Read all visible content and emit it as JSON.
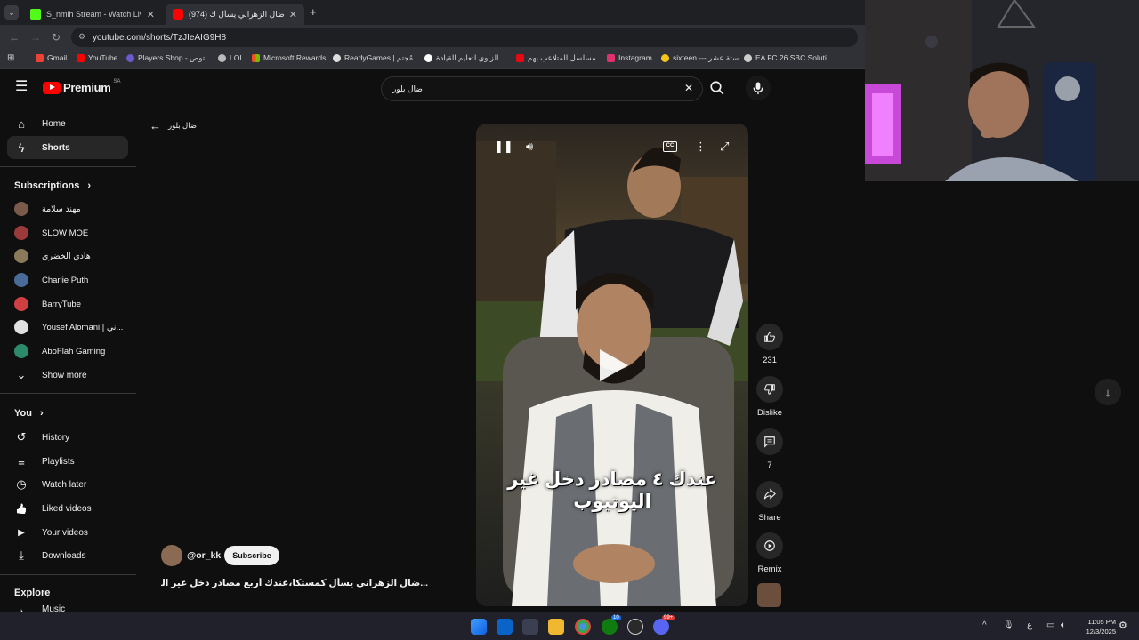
{
  "browser": {
    "tabs": [
      {
        "label": "S_nmlh Stream - Watch Live on",
        "color": "#53fc18"
      },
      {
        "label": "(974) ضال الزهراني يسأل ك",
        "color": "#ff0000"
      }
    ],
    "url": "youtube.com/shorts/TzJIeAIG9H8",
    "bookmarks": [
      {
        "label": "Gmail",
        "color": "#ea4335"
      },
      {
        "label": "YouTube",
        "color": "#ff0000"
      },
      {
        "label": "Players Shop - توص...",
        "color": "#6a5acd"
      },
      {
        "label": "LOL",
        "color": "#bbbbbb"
      },
      {
        "label": "Microsoft Rewards",
        "color": "#00a4ef"
      },
      {
        "label": "ReadyGames | مُجتم...",
        "color": "#ffffff"
      },
      {
        "label": "الزاوي لتعليم القيادة",
        "color": "#ffffff"
      },
      {
        "label": "مسلسل المتلاعب بهم...",
        "color": "#e50914"
      },
      {
        "label": "Instagram",
        "color": "#e1306c"
      },
      {
        "label": "sixteen --- ستة عشر",
        "color": "#f5c518"
      },
      {
        "label": "EA FC 26 SBC Soluti...",
        "color": "#cccccc"
      }
    ]
  },
  "masthead": {
    "logo_text": "Premium",
    "logo_sup": "SA",
    "search_value": "ضال بلور"
  },
  "sidebar": {
    "main": [
      {
        "label": "Home",
        "icon": "home-icon",
        "glyph": "⌂"
      },
      {
        "label": "Shorts",
        "icon": "shorts-icon",
        "glyph": "ϟ"
      }
    ],
    "subscriptions_title": "Subscriptions",
    "subscriptions": [
      {
        "label": "مهند سلامة",
        "color": "#7a5a4a"
      },
      {
        "label": "SLOW MOE",
        "color": "#9a3a3a"
      },
      {
        "label": "هادي الخضري",
        "color": "#8a7a5a"
      },
      {
        "label": "Charlie Puth",
        "color": "#4a6a9a"
      },
      {
        "label": "BarryTube",
        "color": "#d04040"
      },
      {
        "label": "Yousef Alomani | ني...",
        "color": "#e0e0e0"
      },
      {
        "label": "AboFlah Gaming",
        "color": "#2a8a6a"
      }
    ],
    "show_more": "Show more",
    "you_title": "You",
    "you": [
      {
        "label": "History",
        "icon": "history-icon",
        "glyph": "↺"
      },
      {
        "label": "Playlists",
        "icon": "playlists-icon",
        "glyph": "≡"
      },
      {
        "label": "Watch later",
        "icon": "watch-later-icon",
        "glyph": "◷"
      },
      {
        "label": "Liked videos",
        "icon": "like-icon",
        "glyph": "👍"
      },
      {
        "label": "Your videos",
        "icon": "your-videos-icon",
        "glyph": "▶"
      },
      {
        "label": "Downloads",
        "icon": "download-icon",
        "glyph": "⤓"
      }
    ],
    "explore_title": "Explore",
    "explore_partial": "Music"
  },
  "back_label": "ضال بلور",
  "short": {
    "caption": "عندك ٤ مصادر دخل غير اليوتيوب",
    "channel": "@or_kk",
    "subscribe": "Subscribe",
    "title": "...ضال الزهراني يسأل كمستكا،عندك أربع مصادر دخل غير اليوتيوب؟"
  },
  "actions": {
    "like_count": "231",
    "dislike_label": "Dislike",
    "comment_count": "7",
    "share_label": "Share",
    "remix_label": "Remix"
  },
  "taskbar": {
    "time": "11:05 PM",
    "date": "12/3/2025",
    "lang": "ع",
    "badge_xbox": "10",
    "badge_discord": "99+"
  }
}
